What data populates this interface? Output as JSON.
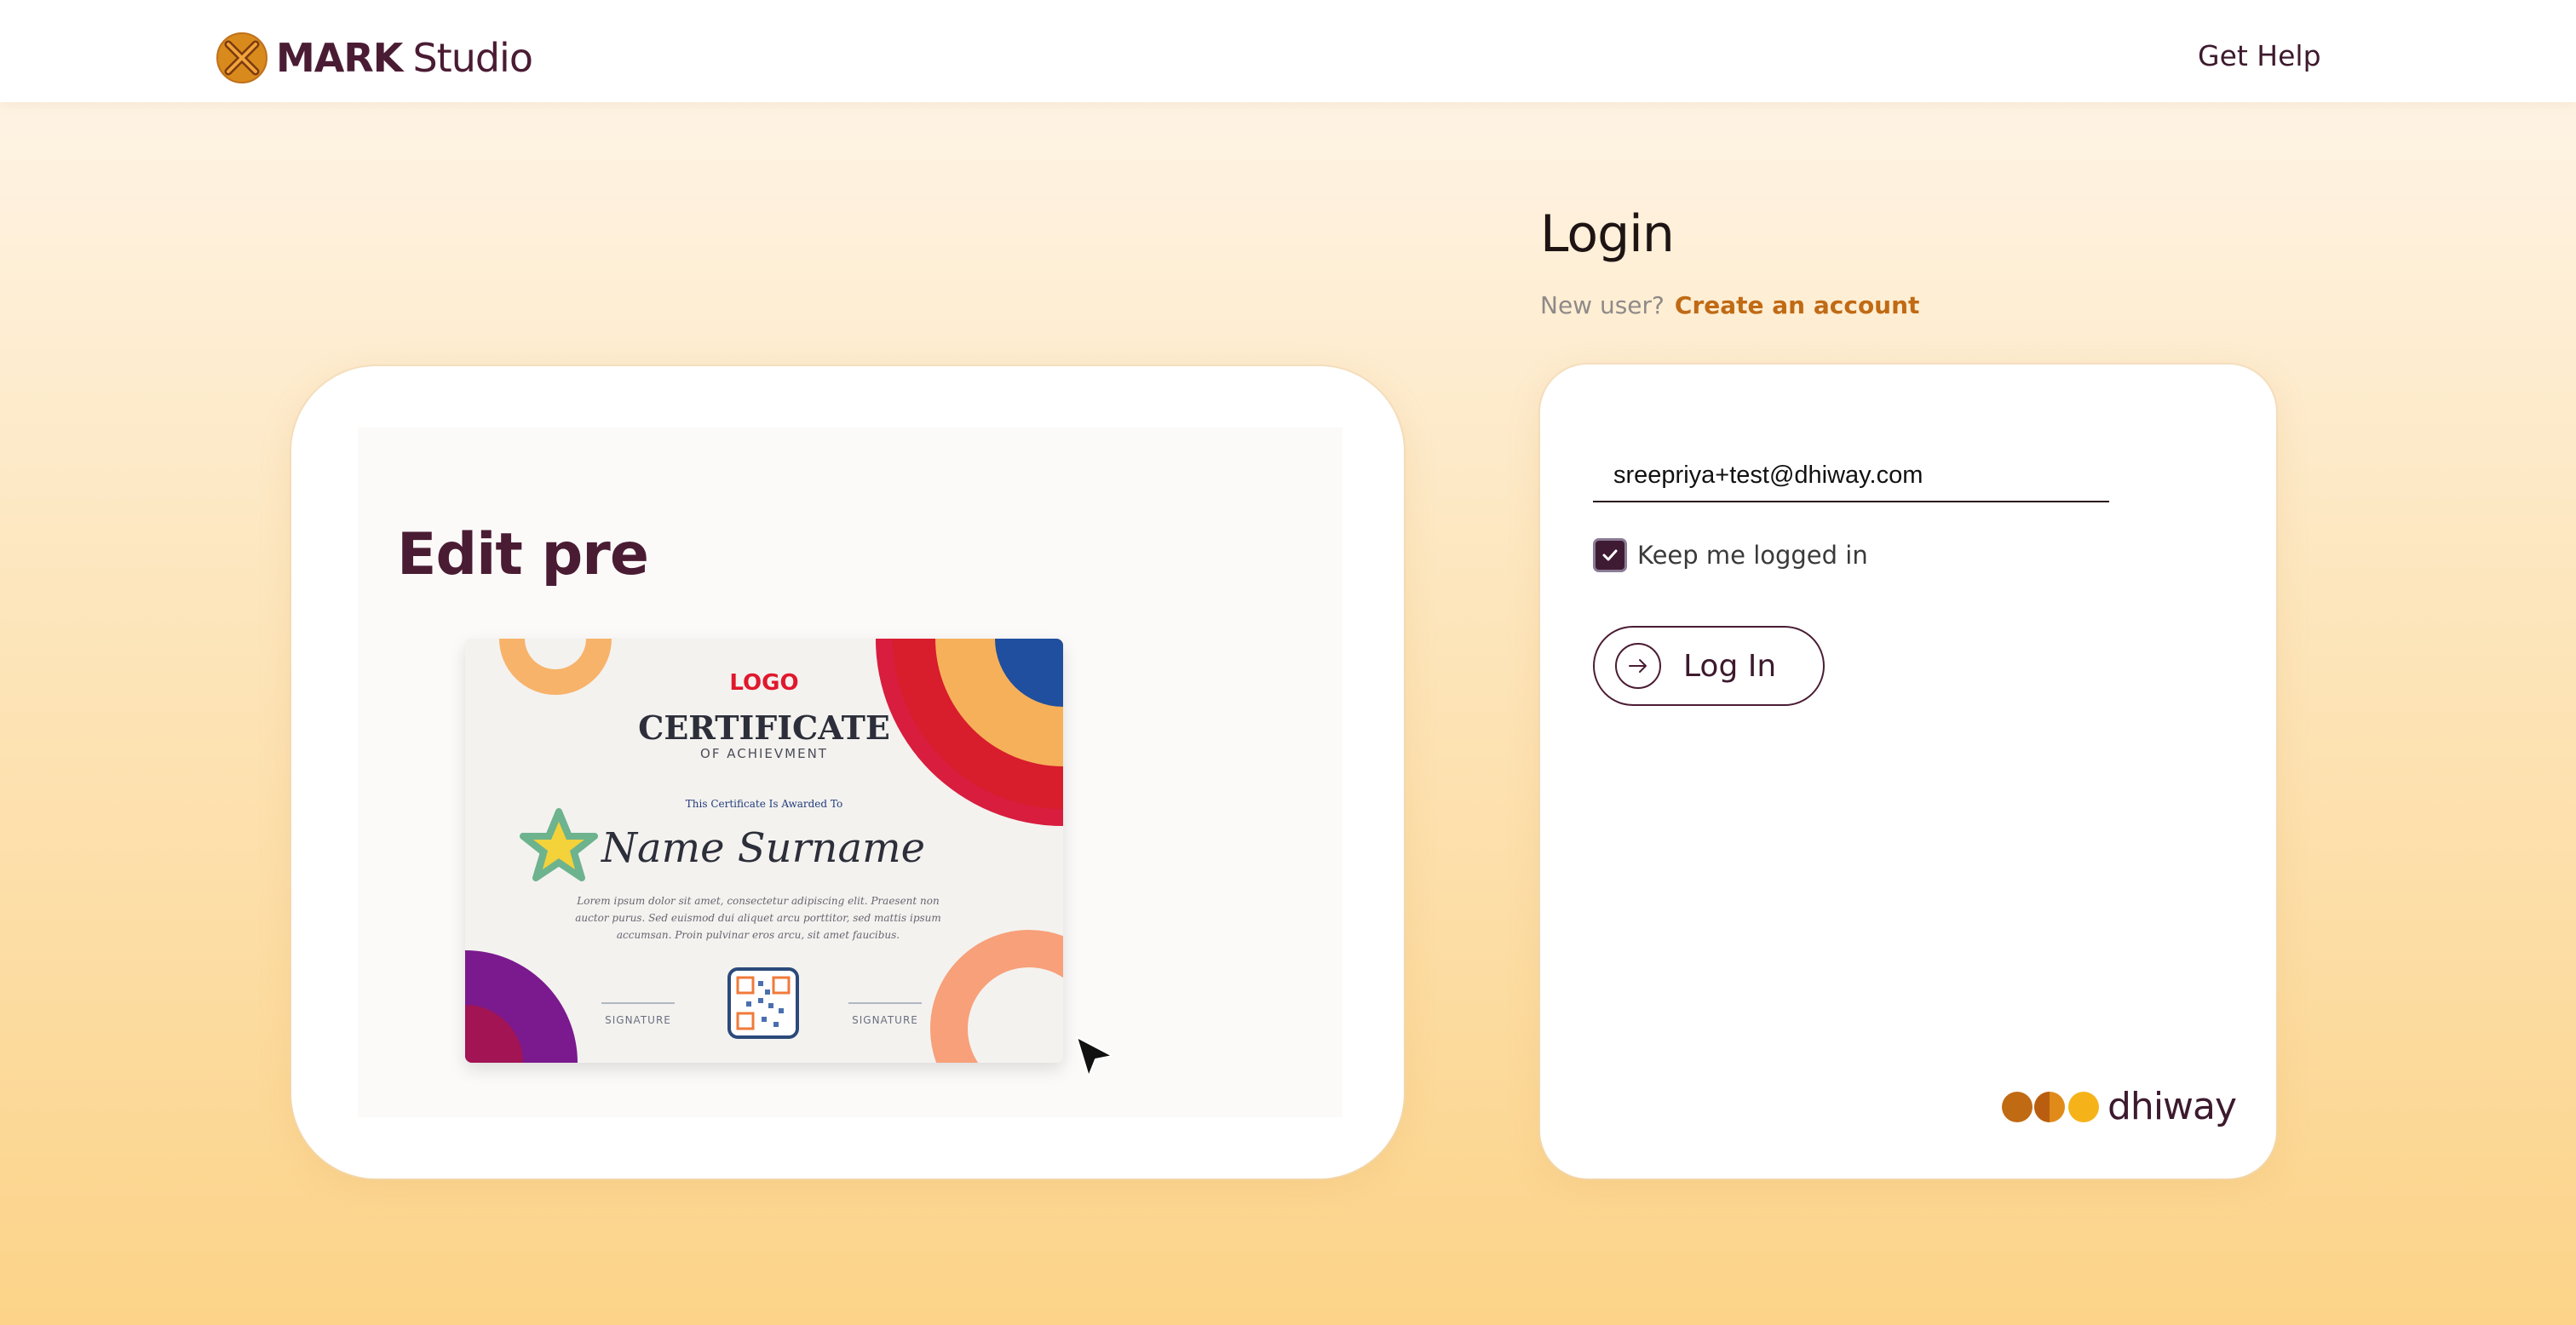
{
  "header": {
    "brand_mark": "MARK",
    "brand_studio": "Studio",
    "help_label": "Get Help"
  },
  "preview": {
    "heading": "Edit pre",
    "certificate": {
      "logo_text": "LOGO",
      "title": "CERTIFICATE",
      "subtitle": "OF ACHIEVMENT",
      "awarded_to": "This Certificate Is Awarded To",
      "name": "Name Surname",
      "body_lines": [
        "Lorem ipsum dolor sit amet, consectetur adipiscing elit. Praesent non",
        "auctor purus. Sed euismod dui aliquet arcu porttitor, sed mattis ipsum",
        "accumsan. Proin pulvinar eros arcu, sit amet faucibus."
      ],
      "signature_left": "SIGNATURE",
      "signature_right": "SIGNATURE"
    }
  },
  "login": {
    "title": "Login",
    "new_user_label": "New user?",
    "create_account_label": "Create an account",
    "email_value": "sreepriya+test@dhiway.com",
    "keep_logged_in_label": "Keep me logged in",
    "keep_logged_in_checked": true,
    "login_button_label": "Log In",
    "partner_logo_text": "dhiway"
  },
  "colors": {
    "brand": "#4a1c33",
    "accent": "#c06a14",
    "background_top": "#fef6ec",
    "background_bottom": "#fcd388"
  },
  "icons": {
    "brand": "mark-logo-icon",
    "login_button": "arrow-right-icon",
    "checkbox": "checkmark-icon",
    "cursor": "mouse-cursor-icon"
  }
}
